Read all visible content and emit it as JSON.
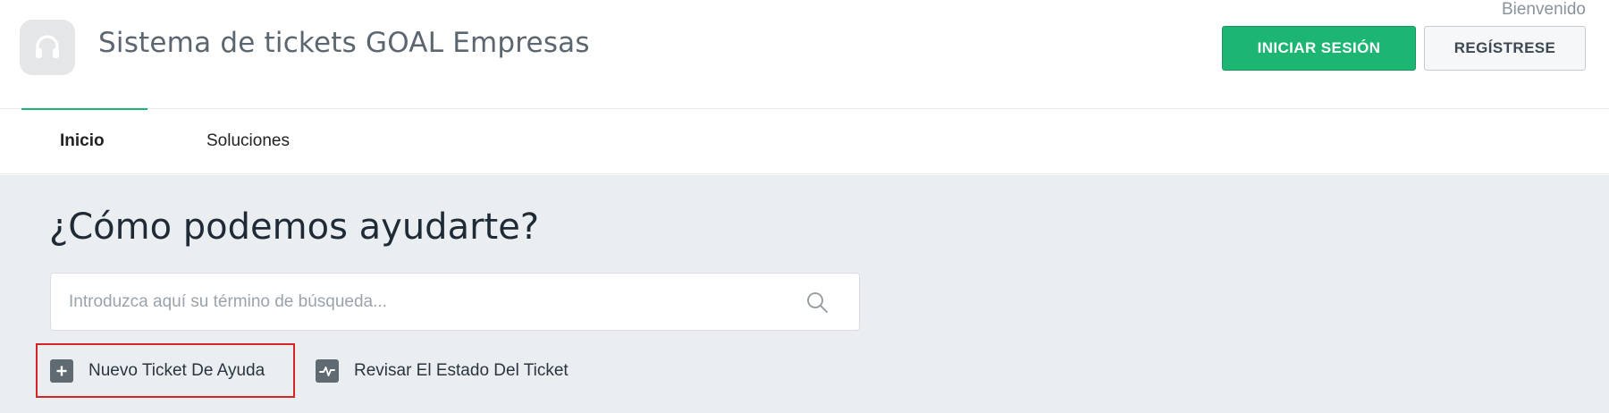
{
  "header": {
    "site_title": "Sistema de tickets GOAL Empresas",
    "welcome": "Bienvenido",
    "login_label": "INICIAR SESIÓN",
    "register_label": "REGÍSTRESE",
    "logo_icon": "headset-icon"
  },
  "nav": {
    "tabs": [
      {
        "label": "Inicio",
        "active": true
      },
      {
        "label": "Soluciones",
        "active": false
      }
    ]
  },
  "main": {
    "heading": "¿Cómo podemos ayudarte?",
    "search": {
      "placeholder": "Introduzca aquí su término de búsqueda...",
      "value": "",
      "icon": "search-icon"
    },
    "actions": [
      {
        "label": "Nuevo Ticket De Ayuda",
        "icon": "plus-icon"
      },
      {
        "label": "Revisar El Estado Del Ticket",
        "icon": "activity-icon"
      }
    ]
  },
  "colors": {
    "accent": "#1cb572",
    "highlight_border": "#d62424",
    "background": "#ebeef0"
  }
}
